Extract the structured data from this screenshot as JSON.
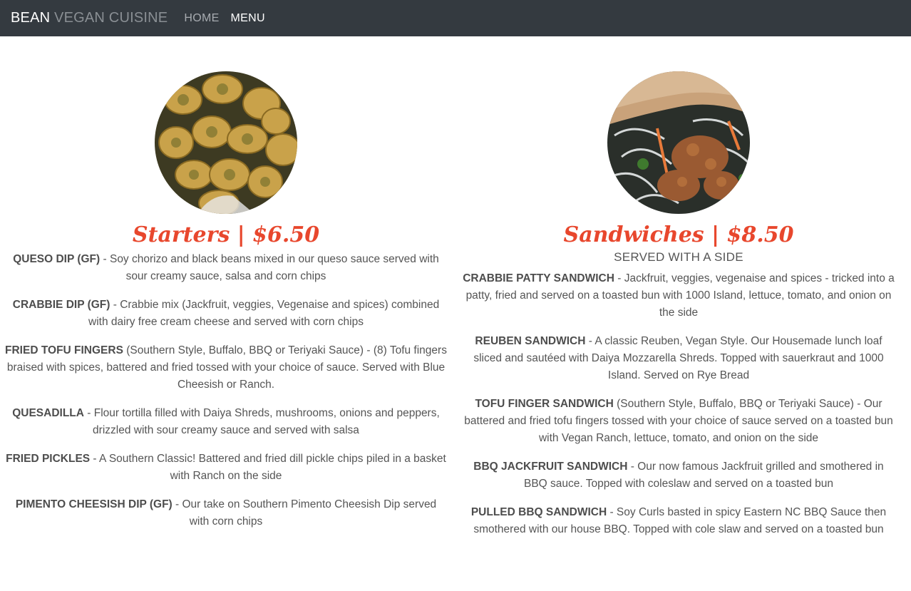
{
  "nav": {
    "brand_main": "BEAN",
    "brand_sub": "VEGAN CUISINE",
    "links": [
      {
        "label": "HOME"
      },
      {
        "label": "MENU"
      }
    ]
  },
  "sections": [
    {
      "title": "Starters | $6.50",
      "image": "fried-pickles-photo",
      "items": [
        {
          "name": "QUESO DIP (GF)",
          "desc": " - Soy chorizo and black beans mixed in our queso sauce served with sour creamy sauce, salsa and corn chips"
        },
        {
          "name": "CRABBIE DIP (GF)",
          "desc": " - Crabbie mix (Jackfruit, veggies, Vegenaise and spices) combined with dairy free cream cheese and served with corn chips"
        },
        {
          "name": "FRIED TOFU FINGERS",
          "desc": " (Southern Style, Buffalo, BBQ or Teriyaki Sauce) - (8) Tofu fingers braised with spices, battered and fried tossed with your choice of sauce. Served with Blue Cheesish or Ranch."
        },
        {
          "name": "QUESADILLA",
          "desc": " - Flour tortilla filled with Daiya Shreds, mushrooms, onions and peppers, drizzled with sour creamy sauce and served with salsa"
        },
        {
          "name": "FRIED PICKLES",
          "desc": " - A Southern Classic! Battered and fried dill pickle chips piled in a basket with Ranch on the side"
        },
        {
          "name": "PIMENTO CHEESISH DIP (GF)",
          "desc": " - Our take on Southern Pimento Cheesish Dip served with corn chips"
        }
      ]
    },
    {
      "title": "Sandwiches | $8.50",
      "subtitle": "SERVED WITH A SIDE",
      "image": "sandwich-photo",
      "items": [
        {
          "name": "CRABBIE PATTY SANDWICH",
          "desc": " - Jackfruit, veggies, vegenaise and spices - tricked into a patty, fried and served on a toasted bun with 1000 Island, lettuce, tomato, and onion on the side"
        },
        {
          "name": "REUBEN SANDWICH",
          "desc": " - A classic Reuben, Vegan Style. Our Housemade lunch loaf sliced and sautéed with Daiya Mozzarella Shreds. Topped with sauerkraut and 1000 Island. Served on Rye Bread"
        },
        {
          "name": "TOFU FINGER SANDWICH",
          "desc": " (Southern Style, Buffalo, BBQ or Teriyaki Sauce) - Our battered and fried tofu fingers tossed with your choice of sauce served on a toasted bun with Vegan Ranch, lettuce, tomato, and onion on the side"
        },
        {
          "name": "BBQ JACKFRUIT SANDWICH",
          "desc": " - Our now famous Jackfruit grilled and smothered in BBQ sauce. Topped with coleslaw and served on a toasted bun"
        },
        {
          "name": "PULLED BBQ SANDWICH",
          "desc": " - Soy Curls basted in spicy Eastern NC BBQ Sauce then smothered with our house BBQ. Topped with cole slaw and served on a toasted bun"
        }
      ]
    }
  ],
  "colors": {
    "navbar": "#343a40",
    "accent": "#e8472d",
    "text": "#555555"
  }
}
